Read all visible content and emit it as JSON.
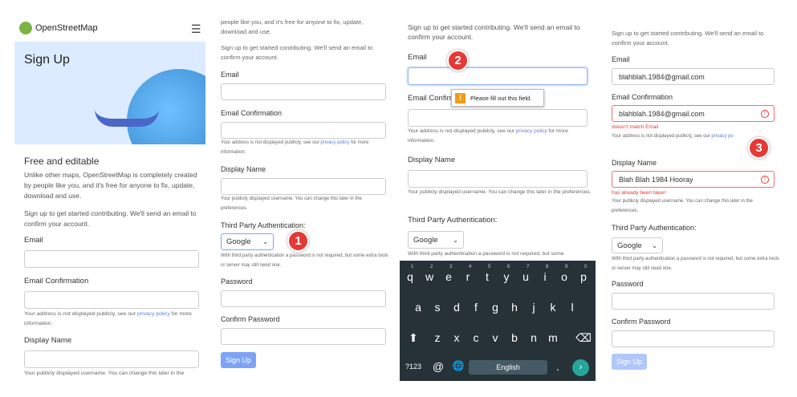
{
  "p1": {
    "brand": "OpenStreetMap",
    "title": "Sign Up",
    "heading": "Free and editable",
    "intro": "Unlike other maps, OpenStreetMap is completely created by people like you, and it's free for anyone to fix, update, download and use.",
    "signup": "Sign up to get started contributing. We'll send an email to confirm your account.",
    "email": "Email",
    "email_conf": "Email Confirmation",
    "addr_pre": "Your address is not displayed publicly, see our ",
    "privacy": "privacy policy",
    "addr_post": " for more information.",
    "display": "Display Name",
    "display_note": "Your publicly displayed username. You can change this later in the"
  },
  "p2": {
    "top": "people like you, and it's free for anyone to fix, update, download and use.",
    "signup": "Sign up to get started contributing. We'll send an email to confirm your account.",
    "email": "Email",
    "email_conf": "Email Confirmation",
    "addr_pre": "Your address is not displayed publicly, see our ",
    "privacy": "privacy policy",
    "addr_post": " for more information.",
    "display": "Display Name",
    "display_note": "Your publicly displayed username. You can change this later in the preferences.",
    "third": "Third Party Authentication:",
    "select": "Google",
    "third_note": "With third party authentication a password is not required, but some extra tools or server may still need one.",
    "password": "Password",
    "confirm": "Confirm Password",
    "button": "Sign Up",
    "badge": "1"
  },
  "p3": {
    "signup": "Sign up to get started contributing. We'll send an email to confirm your account.",
    "email": "Email",
    "email_conf": "Email Confirm",
    "tooltip": "Please fill out this field.",
    "addr_pre": "Your address is not displayed publicly, see our ",
    "privacy": "privacy policy",
    "addr_post": " for more information.",
    "display": "Display Name",
    "display_note": "Your publicly displayed username. You can change this later in the preferences.",
    "third": "Third Party Authentication:",
    "select": "Google",
    "third_note": "With third party authentication a password is not required, but some",
    "badge": "2",
    "keyboard": {
      "row1": [
        "q",
        "w",
        "e",
        "r",
        "t",
        "y",
        "u",
        "i",
        "o",
        "p"
      ],
      "nums": [
        "1",
        "2",
        "3",
        "4",
        "5",
        "6",
        "7",
        "8",
        "9",
        "0"
      ],
      "row2": [
        "a",
        "s",
        "d",
        "f",
        "g",
        "h",
        "j",
        "k",
        "l"
      ],
      "row3": [
        "z",
        "x",
        "c",
        "v",
        "b",
        "n",
        "m"
      ],
      "sym": "?123",
      "at": "@",
      "space": "English",
      "dot": "."
    }
  },
  "p4": {
    "signup": "Sign up to get started contributing. We'll send an email to confirm your account.",
    "email": "Email",
    "email_val": "blahblah.1984@gmail.com",
    "email_conf": "Email Confirmation",
    "email_conf_val": "blahblah.1984@gmail.com",
    "err1": "doesn't match Email",
    "addr_pre": "Your address is not displayed publicly, see our ",
    "privacy": "privacy po",
    "display": "Display Name",
    "display_val": "Blah Blah 1984 Hooray",
    "err2": "has already been taken",
    "display_note": "Your publicly displayed username. You can change this later in the preferences.",
    "third": "Third Party Authentication:",
    "select": "Google",
    "third_note": "With third party authentication a password is not required, but some extra tools or server may still need one.",
    "password": "Password",
    "confirm": "Confirm Password",
    "button": "Sign Up",
    "badge": "3"
  }
}
